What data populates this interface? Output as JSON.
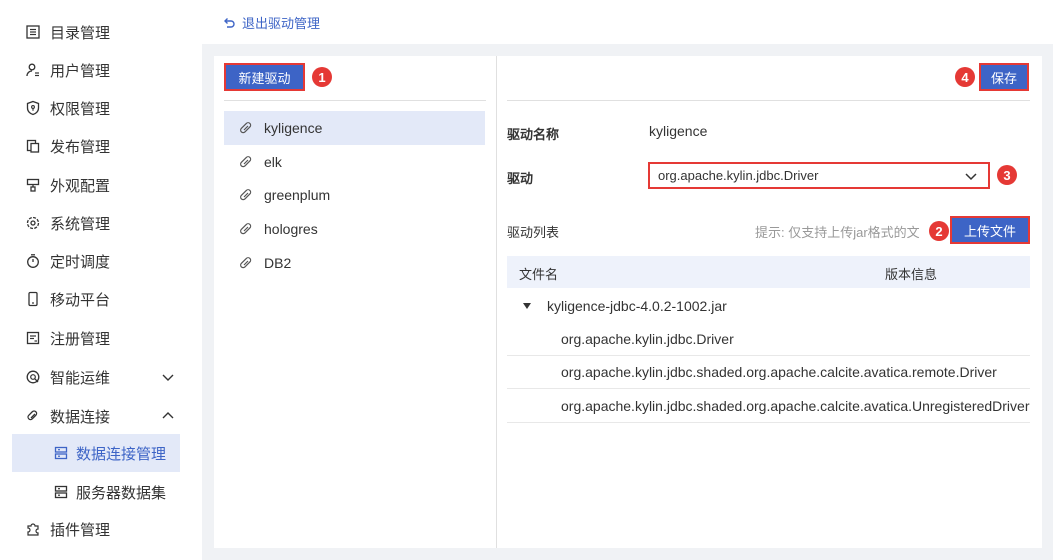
{
  "sidebar": {
    "items": [
      {
        "label": "目录管理",
        "icon": "list-icon"
      },
      {
        "label": "用户管理",
        "icon": "user-icon"
      },
      {
        "label": "权限管理",
        "icon": "shield-icon"
      },
      {
        "label": "发布管理",
        "icon": "publish-icon"
      },
      {
        "label": "外观配置",
        "icon": "appearance-icon"
      },
      {
        "label": "系统管理",
        "icon": "gear-icon"
      },
      {
        "label": "定时调度",
        "icon": "timer-icon"
      },
      {
        "label": "移动平台",
        "icon": "mobile-icon"
      },
      {
        "label": "注册管理",
        "icon": "register-icon"
      },
      {
        "label": "智能运维",
        "icon": "ops-icon",
        "expanded": false
      },
      {
        "label": "数据连接",
        "icon": "link-icon",
        "expanded": true
      },
      {
        "label": "插件管理",
        "icon": "puzzle-icon"
      }
    ],
    "sub_items": [
      {
        "label": "数据连接管理",
        "icon": "database-icon",
        "active": true
      },
      {
        "label": "服务器数据集",
        "icon": "database-icon",
        "active": false
      }
    ]
  },
  "topbar": {
    "back_label": "退出驱动管理"
  },
  "list_panel": {
    "new_button_label": "新建驱动",
    "badge": "1",
    "drivers": [
      {
        "name": "kyligence",
        "active": true
      },
      {
        "name": "elk",
        "active": false
      },
      {
        "name": "greenplum",
        "active": false
      },
      {
        "name": "hologres",
        "active": false
      },
      {
        "name": "DB2",
        "active": false
      }
    ]
  },
  "detail": {
    "save_label": "保存",
    "save_badge": "4",
    "name_label": "驱动名称",
    "name_value": "kyligence",
    "driver_label": "驱动",
    "driver_value": "org.apache.kylin.jdbc.Driver",
    "driver_badge": "3",
    "list_label": "驱动列表",
    "hint": "提示: 仅支持上传jar格式的文",
    "upload_label": "上传文件",
    "upload_badge": "2",
    "table": {
      "col_file": "文件名",
      "col_version": "版本信息",
      "jar": "kyligence-jdbc-4.0.2-1002.jar",
      "classes": [
        "org.apache.kylin.jdbc.Driver",
        "org.apache.kylin.jdbc.shaded.org.apache.calcite.avatica.remote.Driver",
        "org.apache.kylin.jdbc.shaded.org.apache.calcite.avatica.UnregisteredDriver"
      ]
    }
  },
  "colors": {
    "accent": "#3d64c6",
    "active_bg": "#e3e9f8",
    "annotation": "#e53935"
  }
}
